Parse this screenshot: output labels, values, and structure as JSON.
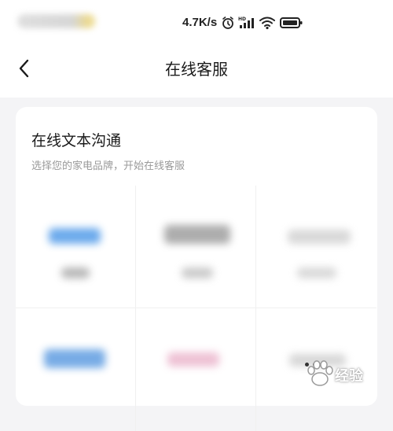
{
  "status_bar": {
    "net_speed": "4.7K/s",
    "icons": [
      "alarm-icon",
      "hd-signal-icon",
      "wifi-icon",
      "battery-icon"
    ]
  },
  "header": {
    "back_icon": "chevron-left-icon",
    "title": "在线客服"
  },
  "card": {
    "title": "在线文本沟通",
    "subtitle": "选择您的家电品牌，开始在线客服",
    "brand_tiles": [
      {
        "logo_color": "#3b8ee6"
      },
      {
        "logo_color": "#9a9a9a"
      },
      {
        "logo_color": "#c8c8c8"
      },
      {
        "logo_color": "#2f7fd8"
      },
      {
        "logo_color": "#e7a7c2"
      },
      {
        "logo_color": "#bdbdbd"
      }
    ]
  },
  "watermark": {
    "text": "经验"
  }
}
